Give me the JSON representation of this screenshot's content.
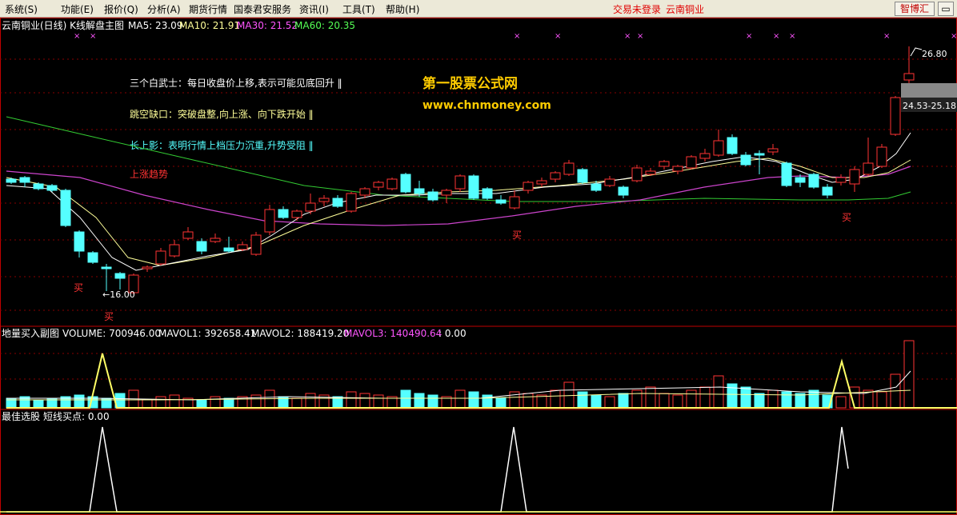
{
  "menu": {
    "items": [
      "系统(S)",
      "功能(E)",
      "报价(Q)",
      "分析(A)",
      "期货行情",
      "国泰君安服务",
      "资讯(I)",
      "工具(T)",
      "帮助(H)"
    ],
    "status_text": "交易未登录",
    "stock_label": "云南铜业",
    "brand_button": "智博汇"
  },
  "main_panel": {
    "title": "云南铜业(日线) K线解盘主图",
    "ma5": "MA5: 23.09",
    "ma10": "MA10: 21.91",
    "ma30": "MA30: 21.52",
    "ma60": "MA60: 20.35",
    "colors": {
      "ma5": "#ffffff",
      "ma10": "#ffff99",
      "ma30": "#ff55ff",
      "ma60": "#55ff55",
      "up": "#ff3333",
      "down": "#55ffff"
    },
    "annotation_1": "三个白武士：每日收盘价上移,表示可能见底回升 ‖",
    "annotation_2": "跳空缺口：突破盘整,向上涨、向下跌开始 ‖",
    "annotation_3": "长上影：表明行情上档压力沉重,升势受阻 ‖",
    "annotation_4": "上涨趋势",
    "watermark_title": "第一股票公式网",
    "watermark_url": "www.chnmoney.com",
    "high_label": "26.80",
    "low_label": "←16.00",
    "price_box": "24.53-25.18",
    "buy_label": "买",
    "sell_mark": "×"
  },
  "volume_panel": {
    "title": "地量买入副图",
    "volume": "VOLUME: 700946.00",
    "mavol1": "MAVOL1: 392658.41",
    "mavol2": "MAVOL2: 188419.20",
    "mavol3": "MAVOL3: 140490.64",
    "extra": ": 0.00"
  },
  "signal_panel": {
    "title": "最佳选股",
    "label": "短线买点: 0.00"
  },
  "chart_data": {
    "type": "candlestick",
    "high": 26.8,
    "low": 16.0,
    "range": [
      24.53,
      25.18
    ],
    "buy_signals": 4,
    "sell_marks": 11
  }
}
